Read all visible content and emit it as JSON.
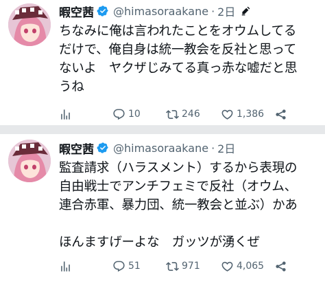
{
  "tweets": [
    {
      "author": "暇空茜",
      "handle": "@himasoraakane",
      "separator": "·",
      "time": "2日",
      "text": "ちなみに俺は言われたことをオウムしてる\nだけで、俺自身は統一教会を反社と思って\nないよ　ヤクザじみてる真っ赤な嘘だと思\nうね",
      "views_icon": "views-icon",
      "reply_count": "10",
      "retweet_count": "246",
      "like_count": "1,386",
      "has_edit_icon": true
    },
    {
      "author": "暇空茜",
      "handle": "@himasoraakane",
      "separator": "·",
      "time": "2日",
      "text": "監査請求（ハラスメント）するから表現の\n自由戦士でアンチフェミで反社（オウム、\n連合赤軍、暴力団、統一教会と並ぶ）かあ\n\nほんますげーよな　ガッツが湧くぜ",
      "reply_count": "51",
      "retweet_count": "971",
      "like_count": "4,065",
      "has_edit_icon": false
    }
  ],
  "colors": {
    "verified": "#1d9bf0",
    "secondary_text": "#536471",
    "primary_text": "#0f1419",
    "background": "#e6e8ea"
  },
  "icons": {
    "verified": "verified-badge-icon",
    "edit": "edit-pencil-icon",
    "views": "views-bar-chart-icon",
    "reply": "reply-bubble-icon",
    "retweet": "retweet-arrows-icon",
    "like": "heart-icon",
    "share": "share-icon"
  }
}
